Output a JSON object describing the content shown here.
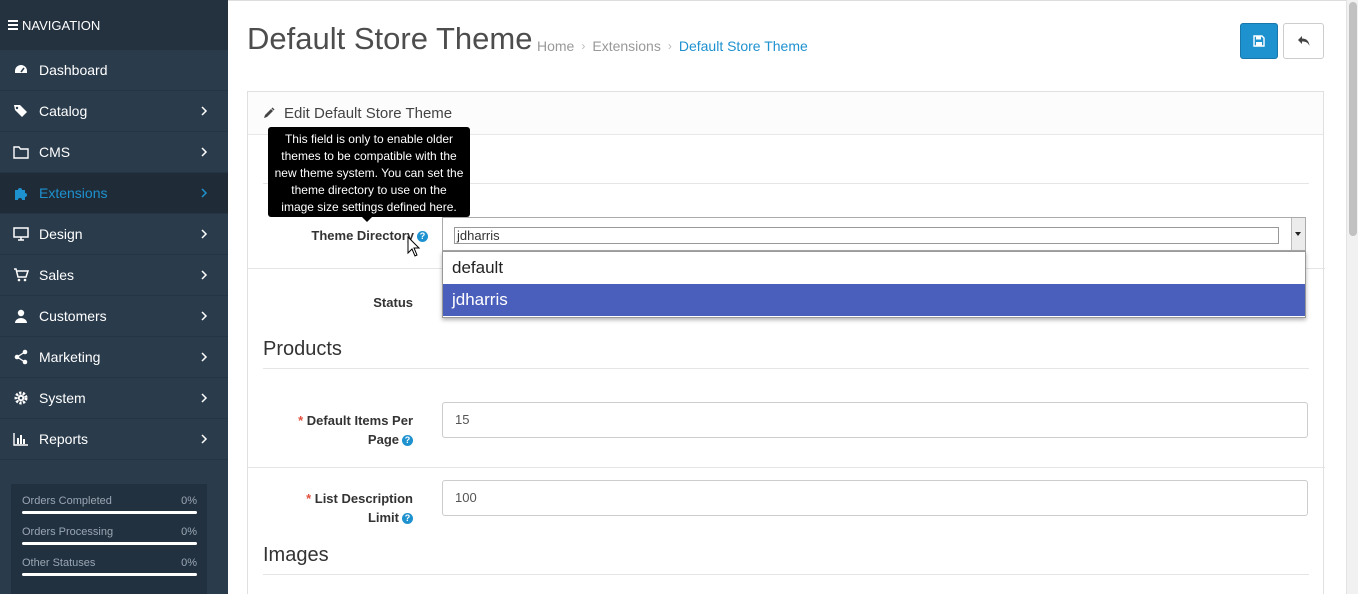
{
  "nav": {
    "title": "NAVIGATION",
    "items": [
      {
        "label": "Dashboard",
        "icon": "dashboard-icon",
        "active": false,
        "chevron": false
      },
      {
        "label": "Catalog",
        "icon": "tags-icon",
        "active": false,
        "chevron": true
      },
      {
        "label": "CMS",
        "icon": "folder-icon",
        "active": false,
        "chevron": true
      },
      {
        "label": "Extensions",
        "icon": "puzzle-icon",
        "active": true,
        "chevron": true
      },
      {
        "label": "Design",
        "icon": "desktop-icon",
        "active": false,
        "chevron": true
      },
      {
        "label": "Sales",
        "icon": "cart-icon",
        "active": false,
        "chevron": true
      },
      {
        "label": "Customers",
        "icon": "user-icon",
        "active": false,
        "chevron": true
      },
      {
        "label": "Marketing",
        "icon": "share-icon",
        "active": false,
        "chevron": true
      },
      {
        "label": "System",
        "icon": "gear-icon",
        "active": false,
        "chevron": true
      },
      {
        "label": "Reports",
        "icon": "bar-chart-icon",
        "active": false,
        "chevron": true
      }
    ]
  },
  "stats": [
    {
      "label": "Orders Completed",
      "value": "0%",
      "progress": 0
    },
    {
      "label": "Orders Processing",
      "value": "0%",
      "progress": 0
    },
    {
      "label": "Other Statuses",
      "value": "0%",
      "progress": 0
    }
  ],
  "header": {
    "title": "Default Store Theme",
    "breadcrumb": [
      "Home",
      "Extensions",
      "Default Store Theme"
    ]
  },
  "panel": {
    "heading": "Edit Default Store Theme",
    "tooltip": "This field is only to enable older themes to be compatible with the new theme system. You can set the theme directory to use on the image size settings defined here.",
    "theme_directory_label": "Theme Directory",
    "theme_directory_value": "jdharris",
    "theme_options": [
      "default",
      "jdharris"
    ],
    "theme_selected": "jdharris",
    "status_label": "Status",
    "products_title": "Products",
    "items_per_page_label_1": "Default Items Per",
    "items_per_page_label_2": "Page",
    "items_per_page_value": "15",
    "desc_limit_label_1": "List Description",
    "desc_limit_label_2": "Limit",
    "desc_limit_value": "100",
    "images_title": "Images",
    "required_mark": "*",
    "help_mark": "?"
  },
  "colors": {
    "accent": "#1e91cf",
    "sidebar": "#2a3b4c",
    "selected_option": "#4a5ebc",
    "required": "#e3503e"
  }
}
